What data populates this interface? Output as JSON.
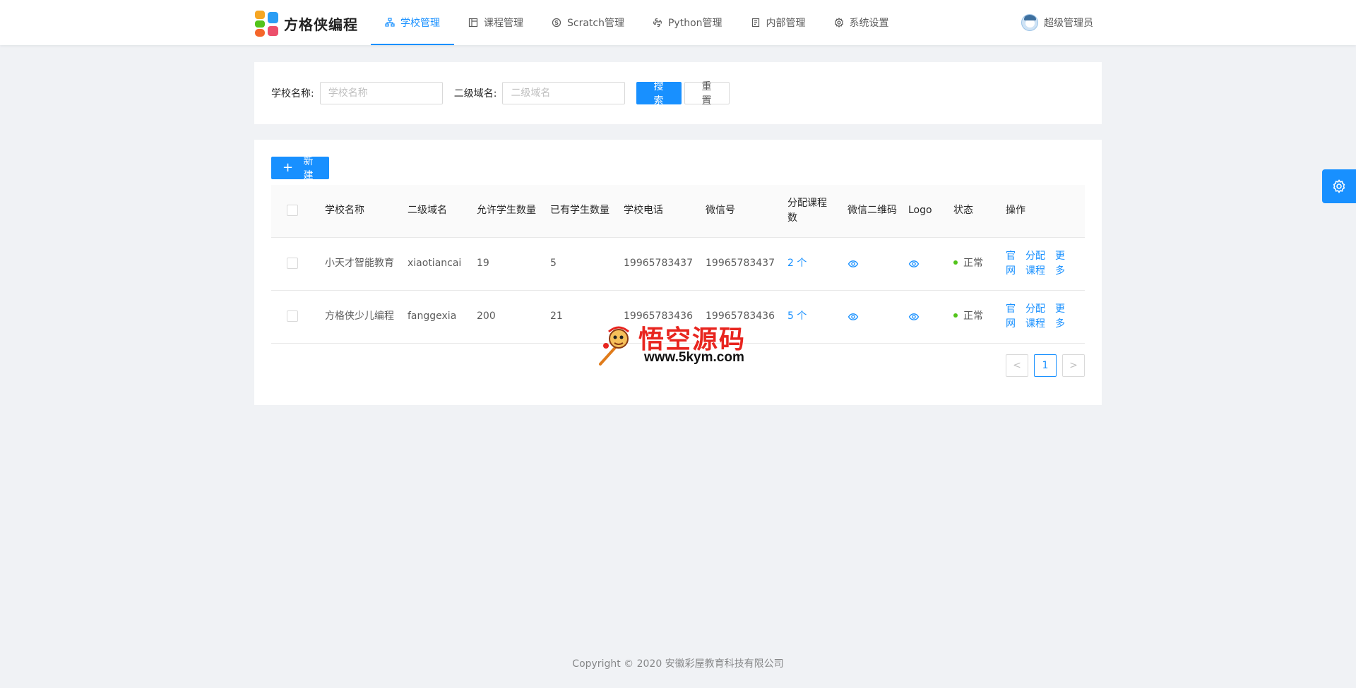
{
  "header": {
    "logo_text": "方格侠编程",
    "nav": [
      {
        "label": "学校管理",
        "icon": "school-icon",
        "active": true
      },
      {
        "label": "课程管理",
        "icon": "course-icon",
        "active": false
      },
      {
        "label": "Scratch管理",
        "icon": "scratch-icon",
        "active": false
      },
      {
        "label": "Python管理",
        "icon": "python-icon",
        "active": false
      },
      {
        "label": "内部管理",
        "icon": "book-icon",
        "active": false
      },
      {
        "label": "系统设置",
        "icon": "gear-icon",
        "active": false
      }
    ],
    "user_name": "超级管理员"
  },
  "search": {
    "school_label": "学校名称:",
    "school_placeholder": "学校名称",
    "school_value": "",
    "domain_label": "二级域名:",
    "domain_placeholder": "二级域名",
    "domain_value": "",
    "search_button": "搜 索",
    "reset_button": "重 置"
  },
  "table": {
    "new_button": "新建",
    "columns": [
      "学校名称",
      "二级域名",
      "允许学生数量",
      "已有学生数量",
      "学校电话",
      "微信号",
      "分配课程数",
      "微信二维码",
      "Logo",
      "状态",
      "操作"
    ],
    "rows": [
      {
        "school": "小天才智能教育",
        "domain": "xiaotiancai",
        "allowed": "19",
        "existing": "5",
        "phone": "19965783437",
        "wechat": "19965783437",
        "courses": "2 个",
        "status": "正常",
        "ops": [
          "官网",
          "分配课程",
          "更多"
        ]
      },
      {
        "school": "方格侠少儿编程",
        "domain": "fanggexia",
        "allowed": "200",
        "existing": "21",
        "phone": "19965783436",
        "wechat": "19965783436",
        "courses": "5 个",
        "status": "正常",
        "ops": [
          "官网",
          "分配课程",
          "更多"
        ]
      }
    ],
    "pagination": {
      "prev": "<",
      "current": "1",
      "next": ">"
    }
  },
  "watermark": {
    "title": "悟空源码",
    "url": "www.5kym.com"
  },
  "footer": {
    "copyright": "Copyright © 2020 安徽彩屋教育科技有限公司"
  },
  "colors": {
    "primary": "#1890ff",
    "status_ok": "#52c41a",
    "background": "#f0f2f5"
  }
}
